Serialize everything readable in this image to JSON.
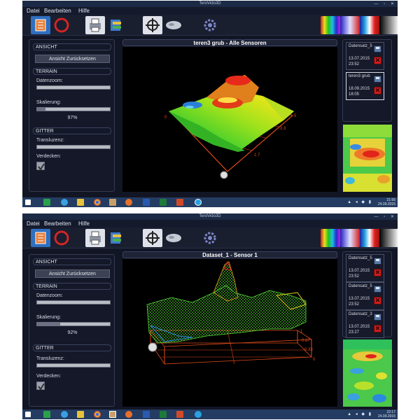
{
  "app_title": "TeroVido3D",
  "menu": [
    "Datei",
    "Bearbeiten",
    "Hilfe"
  ],
  "window_buttons": "— ▫ ✕",
  "colors": {
    "accent": "#3d6fb4",
    "panel": "#141828",
    "viewport": "#000000",
    "delete": "#d21e1e"
  },
  "toolbar_icons": [
    "layers-icon",
    "record-icon",
    "print-icon",
    "export-icon",
    "crosshair-icon",
    "map-icon",
    "gear-icon",
    "palette-rainbow",
    "palette-spectrum",
    "palette-thermal",
    "palette-grayscale"
  ],
  "screens": [
    {
      "left": {
        "ansicht": "ANSICHT",
        "reset": "Ansicht Zurücksetzen",
        "terrain": "TERRAIN",
        "datenzoom": "Datenzoom:",
        "skalierung": "Skalierung:",
        "skalierung_value": "97%",
        "skalierung_level": 97,
        "gitter": "GITTER",
        "transluzenz": "Transluzenz:",
        "verdecken": "Verdecken:"
      },
      "view_title": "teren3 grub - Alle Sensoren",
      "axis_labels": [
        "5",
        "3.3",
        "1.7",
        "0"
      ],
      "datasets": [
        {
          "name": "Datensatz_5",
          "date": "13.07.2015",
          "time": "23:52",
          "selected": false
        },
        {
          "name": "teren3 grub",
          "date": "18.09.2015",
          "time": "18:05",
          "selected": true
        }
      ],
      "clock": {
        "time": "21:56",
        "date": "24.09.2015"
      }
    },
    {
      "left": {
        "ansicht": "ANSICHT",
        "reset": "Ansicht Zurücksetzen",
        "terrain": "TERRAIN",
        "datenzoom": "Datenzoom:",
        "skalierung": "Skalierung:",
        "skalierung_value": "92%",
        "skalierung_level": 92,
        "gitter": "GITTER",
        "transluzenz": "Transluzenz:",
        "verdecken": "Verdecken:"
      },
      "view_title": "Dataset_1 - Sensor 1",
      "axis_labels": [
        "1",
        "0.67",
        "0.33",
        "0"
      ],
      "datasets": [
        {
          "name": "Datensatz_5",
          "date": "13.07.2015",
          "time": "23:52",
          "selected": false
        },
        {
          "name": "Datensatz_5",
          "date": "13.07.2015",
          "time": "23:52",
          "selected": false
        },
        {
          "name": "Datensatz_3",
          "date": "13.07.2015",
          "time": "23:27",
          "selected": false
        }
      ],
      "clock": {
        "time": "22:17",
        "date": "24.09.2015"
      }
    }
  ],
  "taskbar_icons": [
    "windows-start-icon",
    "store-icon",
    "ie-icon",
    "explorer-icon",
    "chrome-icon",
    "app-icon",
    "firefox-icon",
    "word-icon",
    "excel-icon",
    "powerpoint-icon",
    "skype-icon"
  ]
}
